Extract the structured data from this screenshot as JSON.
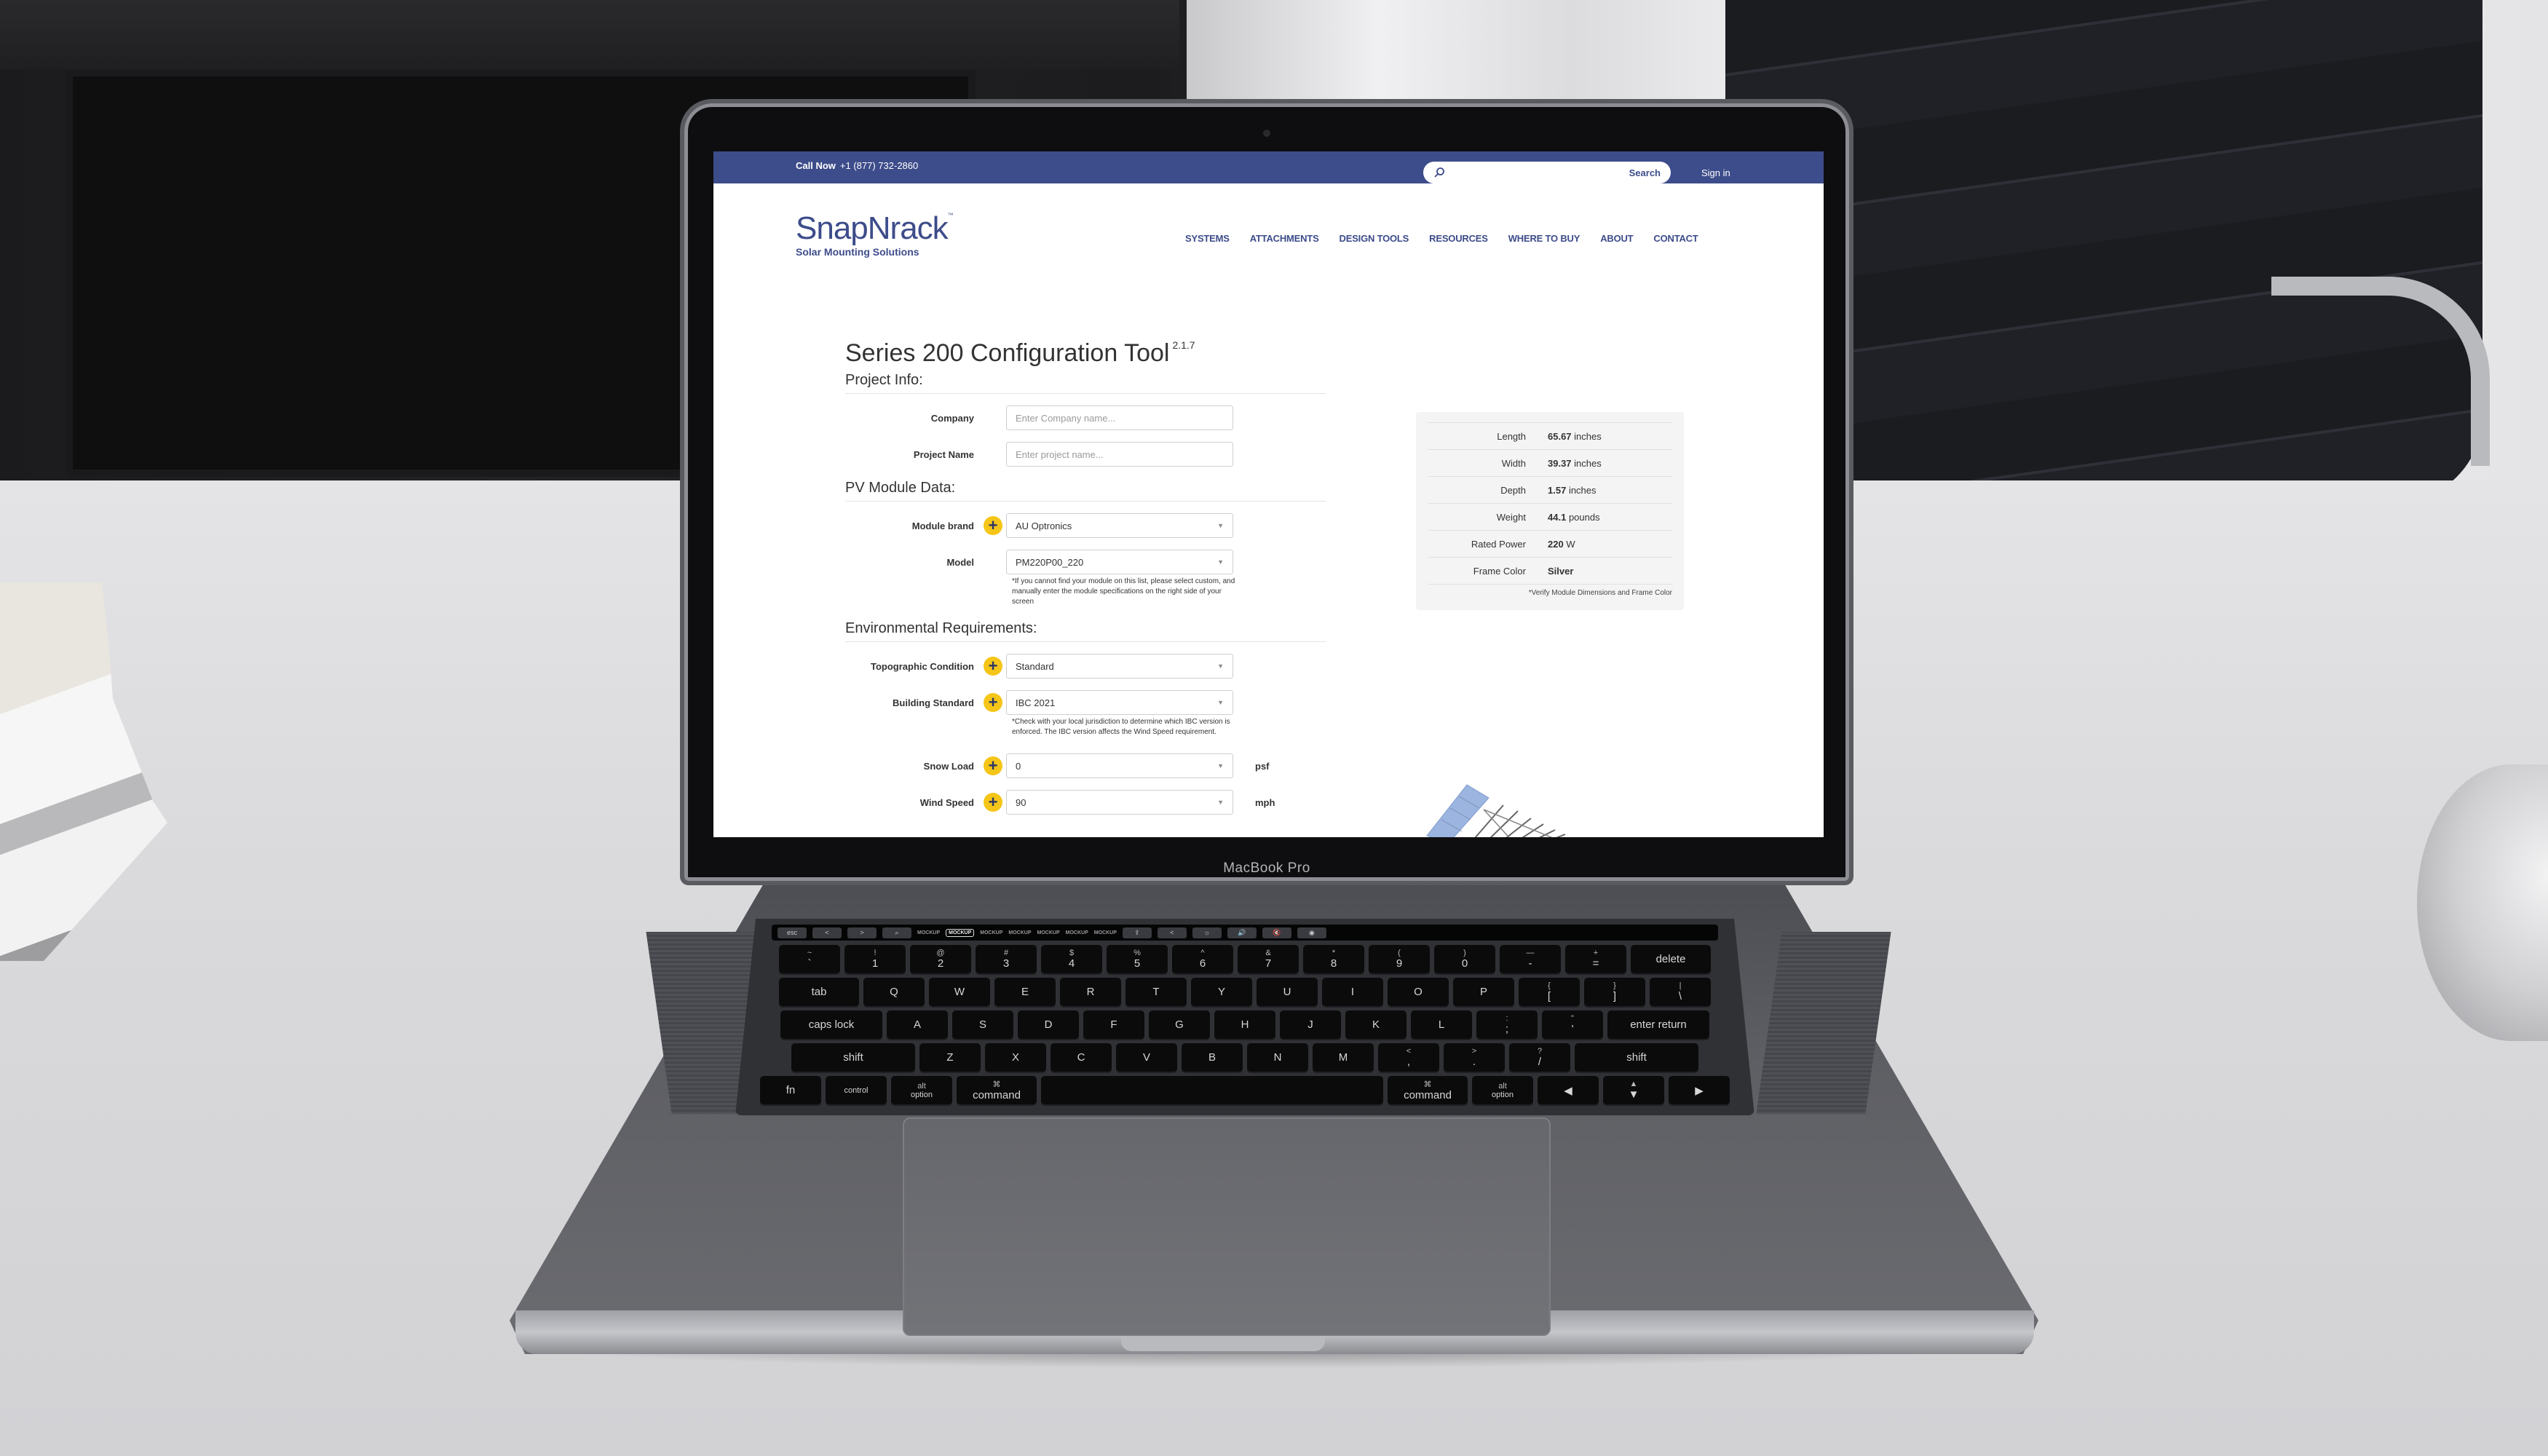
{
  "laptop": {
    "model_label": "MacBook Pro"
  },
  "header": {
    "call_now_label": "Call Now",
    "phone": "+1 (877) 732-2860",
    "search_placeholder": "",
    "search_button": "Search",
    "sign_in": "Sign in"
  },
  "logo": {
    "name": "SnapNrack",
    "trademark": "™",
    "tagline": "Solar Mounting Solutions"
  },
  "nav": {
    "items": [
      "SYSTEMS",
      "ATTACHMENTS",
      "DESIGN TOOLS",
      "RESOURCES",
      "WHERE TO BUY",
      "ABOUT",
      "CONTACT"
    ]
  },
  "tool": {
    "title": "Series 200 Configuration Tool",
    "version": "2.1.7",
    "sections": {
      "project_info": "Project Info:",
      "pv_module": "PV Module Data:",
      "environmental": "Environmental Requirements:"
    },
    "company": {
      "label": "Company",
      "value": "",
      "placeholder": "Enter Company name..."
    },
    "project_name": {
      "label": "Project Name",
      "value": "",
      "placeholder": "Enter project name..."
    },
    "module_brand": {
      "label": "Module brand",
      "value": "AU Optronics"
    },
    "model": {
      "label": "Model",
      "value": "PM220P00_220",
      "note": "*If you cannot find your module on this list, please select custom, and manually enter the module specifications on the right side of your screen"
    },
    "topographic": {
      "label": "Topographic Condition",
      "value": "Standard"
    },
    "building_standard": {
      "label": "Building Standard",
      "value": "IBC 2021",
      "note": "*Check with your local jurisdiction to determine which IBC version is enforced. The IBC version affects the Wind Speed requirement."
    },
    "snow_load": {
      "label": "Snow Load",
      "value": "0",
      "unit": "psf"
    },
    "wind_speed": {
      "label": "Wind Speed",
      "value": "90",
      "unit": "mph"
    }
  },
  "specs": {
    "rows": [
      {
        "label": "Length",
        "value": "65.67",
        "unit": "inches"
      },
      {
        "label": "Width",
        "value": "39.37",
        "unit": "inches"
      },
      {
        "label": "Depth",
        "value": "1.57",
        "unit": "inches"
      },
      {
        "label": "Weight",
        "value": "44.1",
        "unit": "pounds"
      },
      {
        "label": "Rated Power",
        "value": "220",
        "unit": "W"
      },
      {
        "label": "Frame Color",
        "value": "Silver",
        "unit": ""
      }
    ],
    "note": "*Verify Module Dimensions and Frame Color"
  },
  "keyboard": {
    "touchbar": [
      "esc",
      "<",
      ">",
      "search",
      "MOCKUP",
      "MOCKUP",
      "MOCKUP",
      "MOCKUP",
      "MOCKUP",
      "MOCKUP",
      "MOCKUP",
      "share",
      "<",
      "brightness",
      "volume-up",
      "mute",
      "siri"
    ],
    "row1": [
      "~ `",
      "! 1",
      "@ 2",
      "# 3",
      "$ 4",
      "% 5",
      "^ 6",
      "& 7",
      "* 8",
      "( 9",
      ") 0",
      "— -",
      "+ =",
      "delete"
    ],
    "row2": [
      "tab",
      "Q",
      "W",
      "E",
      "R",
      "T",
      "Y",
      "U",
      "I",
      "O",
      "P",
      "{ [",
      "} ]",
      "| \\"
    ],
    "row3": [
      "caps lock",
      "A",
      "S",
      "D",
      "F",
      "G",
      "H",
      "J",
      "K",
      "L",
      ": ;",
      "\" '",
      "enter return"
    ],
    "row4": [
      "shift",
      "Z",
      "X",
      "C",
      "V",
      "B",
      "N",
      "M",
      "< ,",
      "> .",
      "? /",
      "shift"
    ],
    "row5": [
      "fn",
      "control",
      "alt option",
      "⌘ command",
      "",
      "⌘ command",
      "alt option",
      "◀",
      "▲ ▼",
      "▶"
    ]
  },
  "colors": {
    "brand_navy": "#3d4c8a",
    "accent_yellow": "#f5c518"
  }
}
